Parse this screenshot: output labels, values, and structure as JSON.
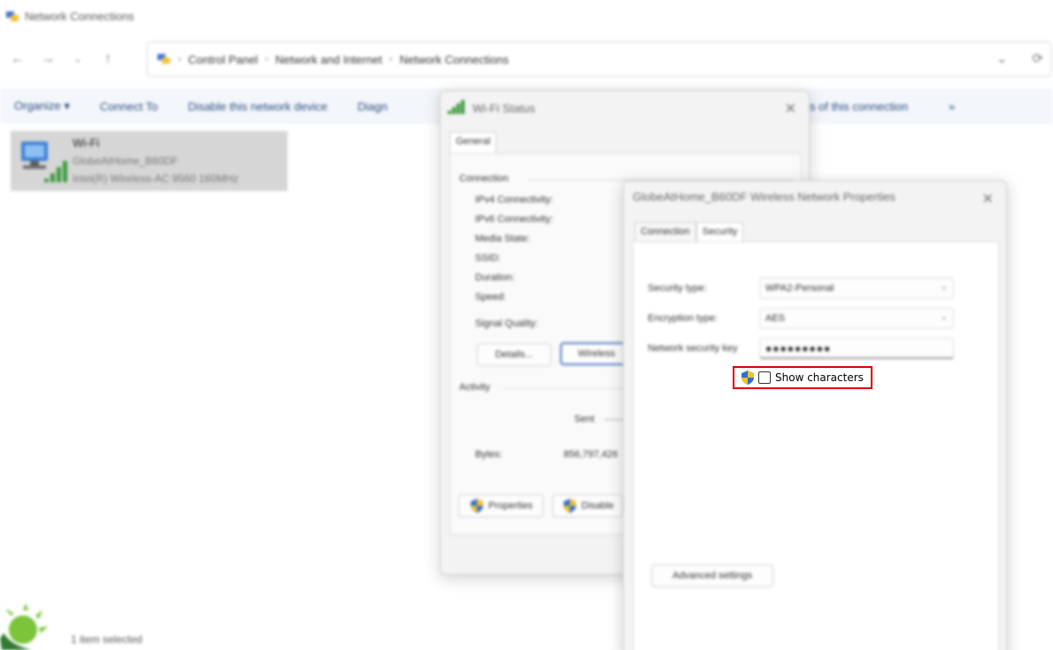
{
  "explorer": {
    "title": "Network Connections",
    "breadcrumb": [
      "Control Panel",
      "Network and Internet",
      "Network Connections"
    ],
    "commands": [
      "Organize ▾",
      "Connect To",
      "Disable this network device",
      "Diagn",
      "s of this connection",
      "»"
    ],
    "connection": {
      "name": "Wi-Fi",
      "ssid": "GlobeAtHome_B60DF",
      "adapter": "Intel(R) Wireless-AC 9560 160MHz"
    },
    "status_text": "1 item selected"
  },
  "wifi_status": {
    "title": "Wi-Fi Status",
    "tab": "General",
    "connection_label": "Connection",
    "fields": [
      "IPv4 Connectivity:",
      "IPv6 Connectivity:",
      "Media State:",
      "SSID:",
      "Duration:",
      "Speed:"
    ],
    "signal_label": "Signal Quality:",
    "details_button": "Details...",
    "wireless_button": "Wireless",
    "activity_label": "Activity",
    "sent_label": "Sent",
    "bytes_label": "Bytes:",
    "bytes_value": "856,797,426",
    "properties_button": "Properties",
    "disable_button": "Disable"
  },
  "wireless_props": {
    "title": "GlobeAtHome_B60DF Wireless Network Properties",
    "tabs": [
      "Connection",
      "Security"
    ],
    "security_type_label": "Security type:",
    "security_type_value": "WPA2-Personal",
    "encryption_type_label": "Encryption type:",
    "encryption_type_value": "AES",
    "key_label": "Network security key",
    "key_value": "●●●●●●●●●",
    "show_characters_label": "Show characters",
    "advanced_button": "Advanced settings"
  },
  "colors": {
    "highlight": "#e00000",
    "signal": "#3c9a3c",
    "command_text": "#2a4a7c"
  }
}
